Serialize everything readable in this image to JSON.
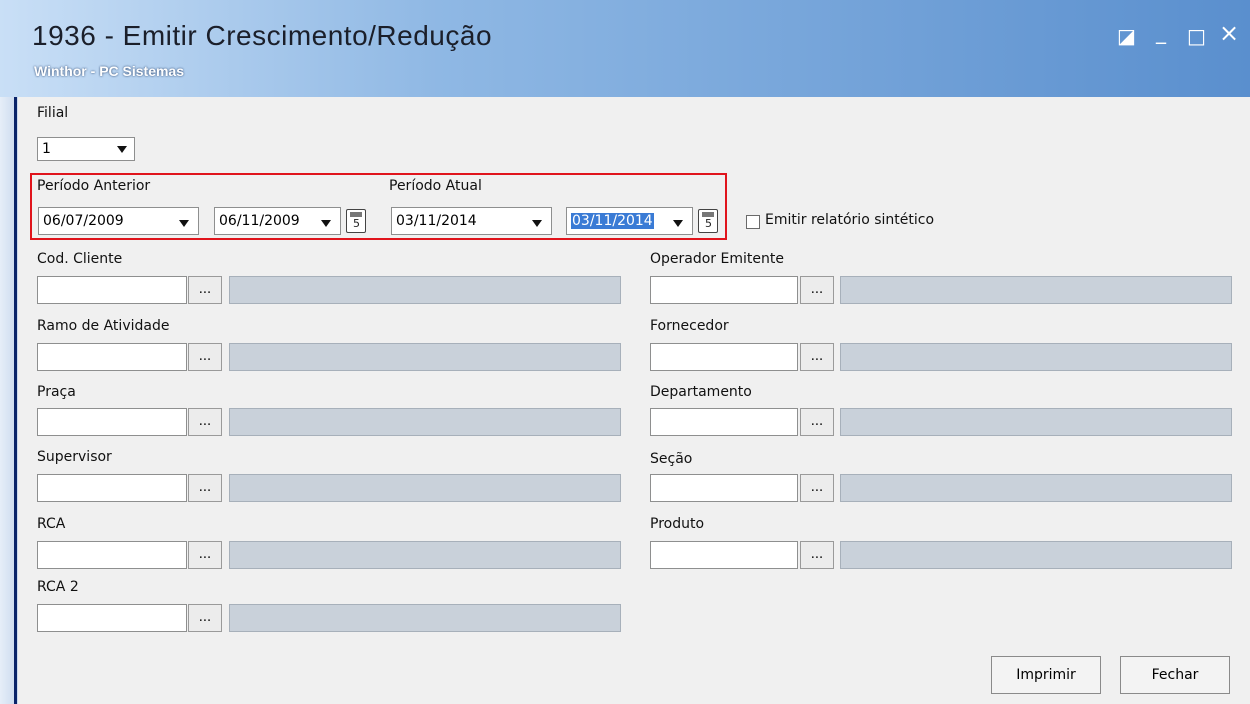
{
  "window": {
    "title": "1936 - Emitir Crescimento/Redução",
    "subtitle": "Winthor - PC Sistemas",
    "controls": {
      "restore": "◪",
      "minimize": "_",
      "maximize": "□",
      "close": "×"
    }
  },
  "filial": {
    "label": "Filial",
    "value": "1"
  },
  "periodo_anterior": {
    "label": "Período Anterior",
    "start": "06/07/2009",
    "end": "06/11/2009"
  },
  "periodo_atual": {
    "label": "Período Atual",
    "start": "03/11/2014",
    "end": "03/11/2014"
  },
  "sintetico": {
    "label": "Emitir relatório sintético",
    "checked": false
  },
  "left_fields": [
    {
      "label": "Cod. Cliente",
      "button": "..."
    },
    {
      "label": "Ramo de Atividade",
      "button": "..."
    },
    {
      "label": "Praça",
      "button": "..."
    },
    {
      "label": "Supervisor",
      "button": "..."
    },
    {
      "label": "RCA",
      "button": "..."
    },
    {
      "label": "RCA 2",
      "button": "..."
    }
  ],
  "right_fields": [
    {
      "label": "Operador Emitente",
      "button": "..."
    },
    {
      "label": "Fornecedor",
      "button": "..."
    },
    {
      "label": "Departamento",
      "button": "..."
    },
    {
      "label": "Seção",
      "button": "..."
    },
    {
      "label": "Produto",
      "button": "..."
    }
  ],
  "actions": {
    "print": "Imprimir",
    "close": "Fechar"
  },
  "colors": {
    "highlight": "#e0141c",
    "selection": "#3a7bd5"
  }
}
